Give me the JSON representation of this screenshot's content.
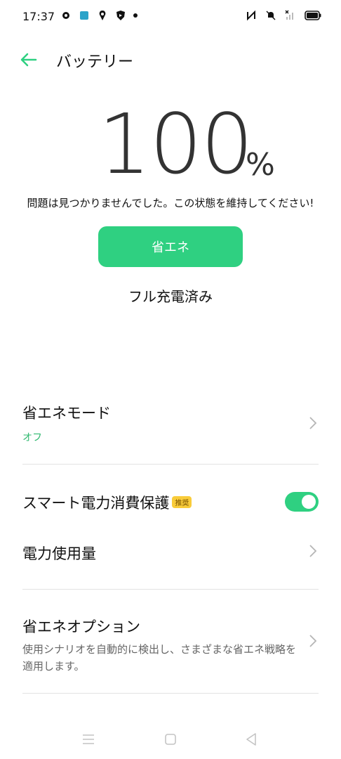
{
  "status_bar": {
    "time": "17:37",
    "icons_left": [
      "settings-icon",
      "app-icon",
      "location-icon",
      "shield-icon",
      "dot-icon"
    ],
    "icons_right": [
      "nfc-icon",
      "mute-icon",
      "signal-icon",
      "battery-icon"
    ]
  },
  "header": {
    "title": "バッテリー",
    "back_icon": "arrow-left-icon"
  },
  "battery": {
    "percent": "100",
    "percent_sign": "%",
    "status_message": "問題は見つかりませんでした。この状態を維持してください!",
    "save_button_label": "省エネ",
    "charge_status": "フル充電済み"
  },
  "settings": {
    "power_saving_mode": {
      "title": "省エネモード",
      "value": "オフ"
    },
    "smart_protection": {
      "title": "スマート電力消費保護",
      "badge": "推奨",
      "enabled": true
    },
    "power_usage": {
      "title": "電力使用量"
    },
    "power_options": {
      "title": "省エネオプション",
      "description": "使用シナリオを自動的に検出し、さまざまな省エネ戦略を適用します。"
    }
  },
  "colors": {
    "accent": "#2fd081",
    "badge": "#f9cc3a",
    "text": "#111111"
  }
}
